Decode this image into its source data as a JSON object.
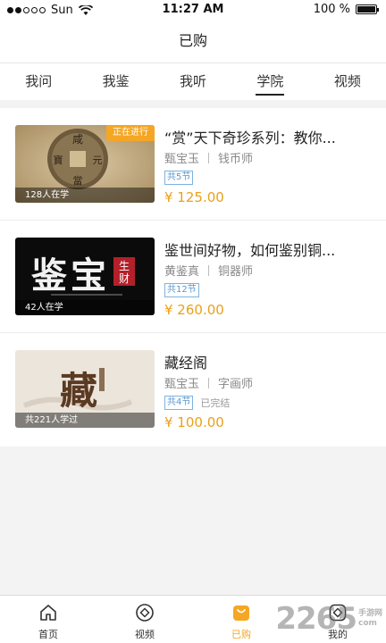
{
  "status_bar": {
    "carrier": "Sun",
    "time": "11:27 AM",
    "battery": "100 %"
  },
  "nav": {
    "title": "已购"
  },
  "tabs": [
    {
      "label": "我问"
    },
    {
      "label": "我鉴"
    },
    {
      "label": "我听"
    },
    {
      "label": "学院",
      "active": true
    },
    {
      "label": "视频"
    }
  ],
  "courses": [
    {
      "title": "“赏”天下奇珍系列：教你...",
      "teacher": "甄宝玉",
      "role": "钱币师",
      "lessons": "共5节",
      "price": "¥ 125.00",
      "learners": "128人在学",
      "live_badge": "正在进行",
      "thumb_icon": "ancient-coin-image"
    },
    {
      "title": "鉴世间好物，如何鉴别铜...",
      "teacher": "黄鉴真",
      "role": "铜器师",
      "lessons": "共12节",
      "price": "¥ 260.00",
      "learners": "42人在学",
      "thumb_icon": "calligraphy-image"
    },
    {
      "title": "藏经阁",
      "teacher": "甄宝玉",
      "role": "字画师",
      "lessons": "共4节",
      "status": "已完结",
      "price": "¥ 100.00",
      "learners": "共221人学过",
      "thumb_icon": "calligraphy-image"
    }
  ],
  "tabbar": [
    {
      "label": "首页",
      "icon": "home-icon"
    },
    {
      "label": "视频",
      "icon": "video-icon"
    },
    {
      "label": "已购",
      "icon": "bag-icon",
      "active": true
    },
    {
      "label": "我的",
      "icon": "profile-icon"
    }
  ],
  "watermark": {
    "number": "2265",
    "line1": "手游网",
    "line2": "com"
  },
  "colors": {
    "accent": "#f5a623",
    "price": "#e9a11b",
    "tag_blue": "#5a97cf"
  }
}
